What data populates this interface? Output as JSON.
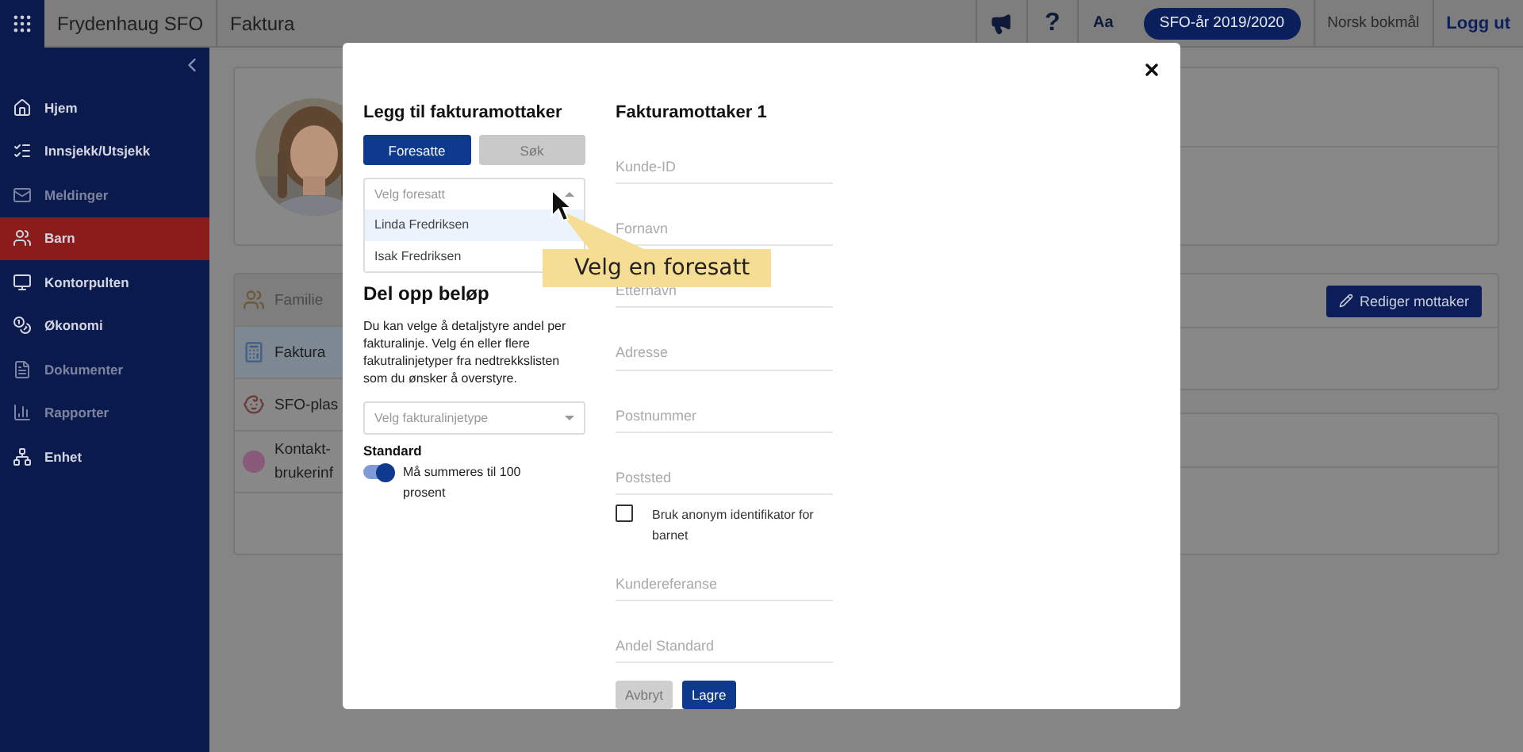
{
  "top_bar": {
    "app_name": "Frydenhaug SFO",
    "page_title": "Faktura",
    "help": "?",
    "font_size": "Aa",
    "school_year": "SFO-år 2019/2020",
    "language": "Norsk bokmål",
    "logout": "Logg ut"
  },
  "sidebar": {
    "items": [
      {
        "label": "Hjem",
        "selected": false,
        "disabled": false
      },
      {
        "label": "Innsjekk/Utsjekk",
        "selected": false,
        "disabled": false
      },
      {
        "label": "Meldinger",
        "selected": false,
        "disabled": true
      },
      {
        "label": "Barn",
        "selected": true,
        "disabled": false
      },
      {
        "label": "Kontorpulten",
        "selected": false,
        "disabled": false
      },
      {
        "label": "Økonomi",
        "selected": false,
        "disabled": false
      },
      {
        "label": "Dokumenter",
        "selected": false,
        "disabled": true
      },
      {
        "label": "Rapporter",
        "selected": false,
        "disabled": true
      },
      {
        "label": "Enhet",
        "selected": false,
        "disabled": false
      }
    ]
  },
  "child_page": {
    "sections": [
      {
        "label": "Familie",
        "selected": false
      },
      {
        "label": "Faktura",
        "selected": true
      },
      {
        "label": "SFO-plas",
        "selected": false
      },
      {
        "label": "Kontakt-\nbrukerinf",
        "selected": false
      }
    ],
    "edit_button": "Rediger mottaker"
  },
  "dialog": {
    "left_title": "Legg til fakturamottaker",
    "tabs": [
      {
        "label": "Foresatte",
        "selected": true
      },
      {
        "label": "Søk",
        "selected": false
      }
    ],
    "parent_select": {
      "placeholder": "Velg foresatt",
      "expanded": true,
      "options": [
        {
          "label": "Linda Fredriksen",
          "selected": true
        },
        {
          "label": "Isak Fredriksen",
          "selected": false
        }
      ]
    },
    "split_title": "Del opp beløp",
    "split_text": "Du kan velge å detaljstyre andel per fakturalinje. Velg én eller flere fakutralinjetyper fra nedtrekkslisten som du ønsker å overstyre.",
    "line_type_select": {
      "placeholder": "Velg fakturalinjetype"
    },
    "standard_label": "Standard",
    "toggle": {
      "on": true,
      "label": "Må summeres til 100 prosent"
    },
    "right_title": "Fakturamottaker 1",
    "fields": [
      {
        "kind": "field",
        "placeholder": "Kunde-ID"
      },
      {
        "kind": "field",
        "placeholder": "Fornavn"
      },
      {
        "kind": "field",
        "placeholder": "Etternavn"
      },
      {
        "kind": "field",
        "placeholder": "Adresse"
      },
      {
        "kind": "field",
        "placeholder": "Postnummer"
      },
      {
        "kind": "field",
        "placeholder": "Poststed"
      },
      {
        "kind": "checkbox",
        "label": "Bruk anonym identifikator for barnet",
        "checked": false
      },
      {
        "kind": "field",
        "placeholder": "Kundereferanse"
      },
      {
        "kind": "field",
        "placeholder": "Andel Standard"
      }
    ],
    "buttons": [
      {
        "label": "Avbryt",
        "kind": "secondary"
      },
      {
        "label": "Lagre",
        "kind": "primary"
      }
    ]
  },
  "tooltip": "Velg en foresatt"
}
